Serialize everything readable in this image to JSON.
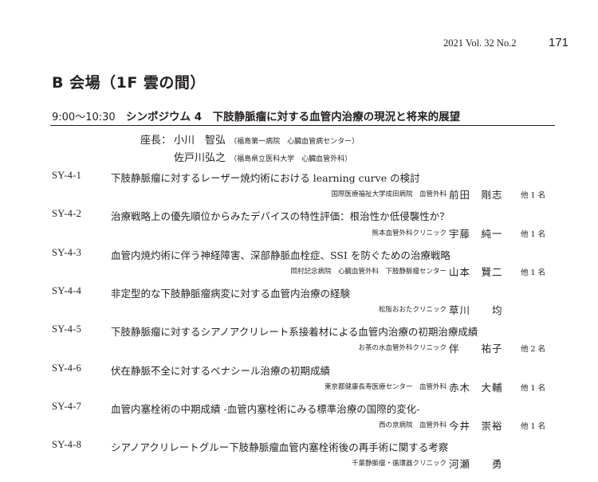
{
  "header": {
    "journal": "2021 Vol. 32 No.2",
    "page_number": "171"
  },
  "room": "B 会場（1F 雲の間）",
  "session": {
    "time": "9:00〜10:30",
    "title": "シンポジウム 4　下肢静脈瘤に対する血管内治療の現況と将来的展望"
  },
  "chairs": {
    "label": "座長：",
    "people": [
      {
        "name": "小川　智弘",
        "affiliation": "（福島第一病院　心臓血管病センター）"
      },
      {
        "name": "佐戸川弘之",
        "affiliation": "（福島県立医科大学　心臓血管外科）"
      }
    ]
  },
  "presentations": [
    {
      "id": "SY-4-1",
      "title": "下肢静脈瘤に対するレーザー焼灼術における learning curve の検討",
      "affiliation": "国際医療福祉大学成田病院　血管外科",
      "presenter": "前田　剛志",
      "others": "他 1 名"
    },
    {
      "id": "SY-4-2",
      "title": "治療戦略上の優先順位からみたデバイスの特性評価：根治性か低侵襲性か？",
      "affiliation": "熊本血管外科クリニック",
      "presenter": "宇藤　純一",
      "others": "他 1 名"
    },
    {
      "id": "SY-4-3",
      "title": "血管内焼灼術に伴う神経障害、深部静脈血栓症、SSI を防ぐための治療戦略",
      "affiliation": "岡村記念病院　心臓血管外科　下肢静脈瘤センター",
      "presenter": "山本　賢二",
      "others": "他 1 名"
    },
    {
      "id": "SY-4-4",
      "title": "非定型的な下肢静脈瘤病変に対する血管内治療の経験",
      "affiliation": "松阪おおたクリニック",
      "presenter": "草川　　均",
      "others": ""
    },
    {
      "id": "SY-4-5",
      "title": "下肢静脈瘤に対するシアノアクリレート系接着材による血管内治療の初期治療成績",
      "affiliation": "お茶の水血管外科クリニック",
      "presenter": "伴　　祐子",
      "others": "他 2 名"
    },
    {
      "id": "SY-4-6",
      "title": "伏在静脈不全に対するベナシール治療の初期成績",
      "affiliation": "東京都健康長寿医療センター　血管外科",
      "presenter": "赤木　大輔",
      "others": "他 1 名"
    },
    {
      "id": "SY-4-7",
      "title": "血管内塞栓術の中期成績 -血管内塞栓術にみる標準治療の国際的変化-",
      "affiliation": "西の京病院　血管外科",
      "presenter": "今井　崇裕",
      "others": "他 1 名"
    },
    {
      "id": "SY-4-8",
      "title": "シアノアクリレートグルー下肢静脈瘤血管内塞栓術後の再手術に関する考察",
      "affiliation": "千葉静脈瘤・循環器クリニック",
      "presenter": "河瀬　　勇",
      "others": ""
    }
  ]
}
